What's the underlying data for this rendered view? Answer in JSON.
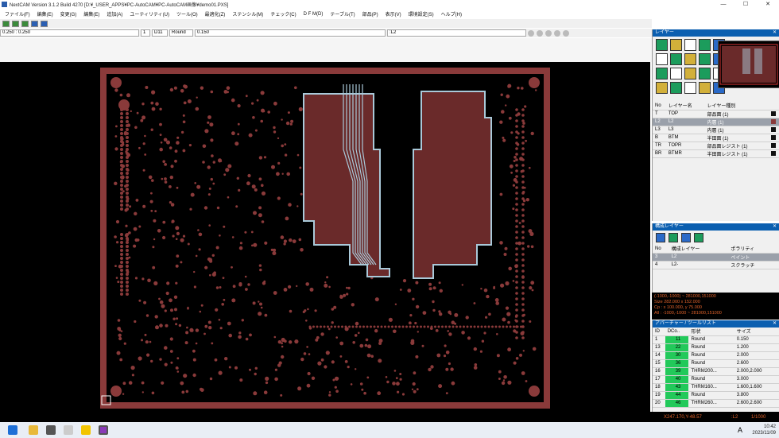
{
  "window": {
    "title": "NextCAM Version 3.1.2 Build 4270 [D:¥_USER_APPS¥PC-AutoCAM¥PC-AutoCAM画像¥demo01.PXS]",
    "minimize": "—",
    "maximize": "☐",
    "close": "✕"
  },
  "menu": [
    "ファイル(F)",
    "編集(E)",
    "変更(G)",
    "編集(E)",
    "追加(A)",
    "ユーティリティ(U)",
    "ツール(O)",
    "最適化(Z)",
    "ステンシル(M)",
    "チェック(C)",
    "D F M(D)",
    "テーブル(T)",
    "部品(P)",
    "表示(V)",
    "環境設定(S)",
    "ヘルプ(H)"
  ],
  "inputbar": {
    "coord_field": "0.250 : 0.250",
    "aperture_no": "1",
    "dcode": "D11",
    "shape": "Round",
    "size": "0.150",
    "layer": ":L2"
  },
  "colors": {
    "pcb_copper": "#8a3a3a",
    "pcb_trace_highlight": "#a9c9d9",
    "panel_title": "#0b5fb0",
    "dcode_green": "#22c95a",
    "status_orange": "#e0622a"
  },
  "layer_panel": {
    "title": "レイヤー",
    "headers": [
      "No",
      "レイヤー名",
      "レイヤー種別"
    ],
    "rows": [
      {
        "no": "T",
        "name": "TOP",
        "type": "部品面 (1)"
      },
      {
        "no": "L2",
        "name": "L2",
        "type": "内層 (1)"
      },
      {
        "no": "L3",
        "name": "L3",
        "type": "内層 (1)"
      },
      {
        "no": "B",
        "name": "BTM",
        "type": "半田面 (1)"
      },
      {
        "no": "TR",
        "name": "TOPR",
        "type": "部品面レジスト (1)"
      },
      {
        "no": "BR",
        "name": "BTMR",
        "type": "半田面レジスト (1)"
      }
    ],
    "selected_index": 1
  },
  "compose_panel": {
    "title": "構成レイヤー",
    "headers": [
      "No",
      "構成レイヤー",
      "ポラリティ"
    ],
    "rows": [
      {
        "no": "3",
        "name": "L2",
        "polarity": "ペイント"
      },
      {
        "no": "4",
        "name": "L2-",
        "polarity": "スクラッチ"
      }
    ]
  },
  "info": {
    "line1": "(-1000,-1000) ~ 281000,151000",
    "line2": "Size 282.000 x 152.000",
    "line3": "Cp : x 100.000, y 75.000",
    "line4": "All : -1000,-1000 ~ 281000,151000"
  },
  "aperture_panel": {
    "title": "アパーチャー / ツールリスト",
    "headers": [
      "ID",
      "DCo..",
      "形状",
      "サイズ"
    ],
    "rows": [
      {
        "id": "1",
        "dc": "11",
        "shape": "Round",
        "size": "0.150"
      },
      {
        "id": "13",
        "dc": "22",
        "shape": "Round",
        "size": "1.200"
      },
      {
        "id": "14",
        "dc": "30",
        "shape": "Round",
        "size": "2.000"
      },
      {
        "id": "15",
        "dc": "36",
        "shape": "Round",
        "size": "2.600"
      },
      {
        "id": "16",
        "dc": "39",
        "shape": "THRM200...",
        "size": "2.000,2.000"
      },
      {
        "id": "17",
        "dc": "40",
        "shape": "Round",
        "size": "3.000"
      },
      {
        "id": "18",
        "dc": "43",
        "shape": "THRM160...",
        "size": "1.600,1.600"
      },
      {
        "id": "19",
        "dc": "44",
        "shape": "Round",
        "size": "3.800"
      },
      {
        "id": "20",
        "dc": "46",
        "shape": "THRM260...",
        "size": "2.600,2.600"
      }
    ]
  },
  "status": {
    "coord": "X247.170,Y-48.57",
    "layer": ":L2",
    "scale": "1/1000"
  },
  "tray": {
    "time": "10:42",
    "date": "2023/11/09",
    "ime": "A"
  }
}
